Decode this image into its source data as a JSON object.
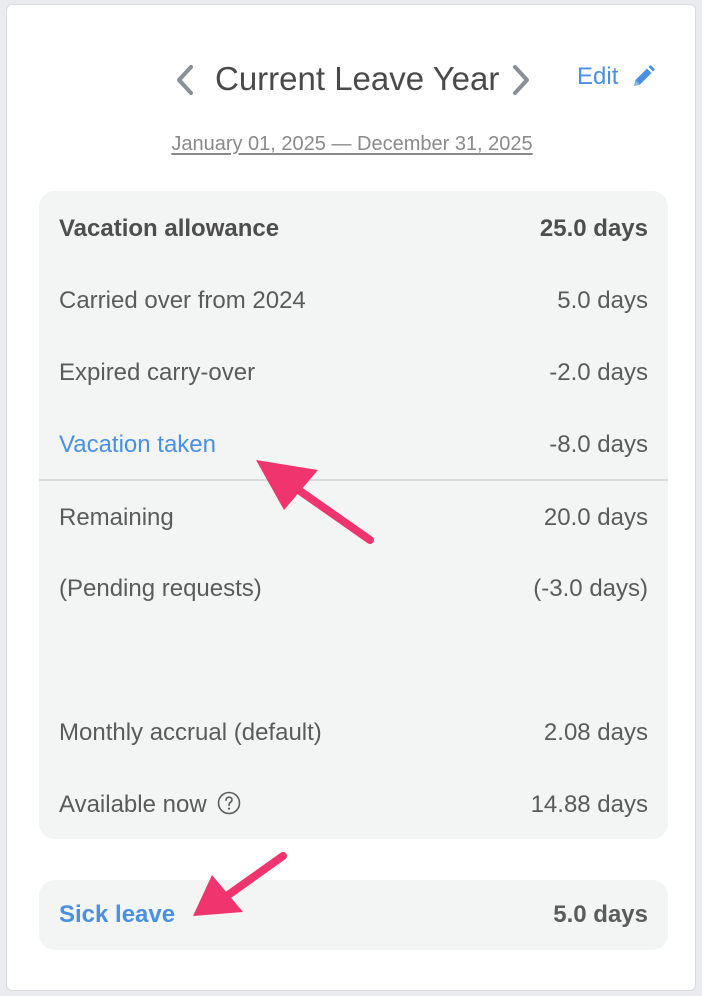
{
  "header": {
    "title": "Current Leave Year",
    "edit_label": "Edit",
    "date_range": "January 01, 2025 — December 31, 2025"
  },
  "vacation": {
    "rows": [
      {
        "label": "Vacation allowance",
        "value": "25.0 days"
      },
      {
        "label": "Carried over from 2024",
        "value": "5.0 days"
      },
      {
        "label": "Expired carry-over",
        "value": "-2.0 days"
      },
      {
        "label": "Vacation taken",
        "value": "-8.0 days"
      },
      {
        "label": "Remaining",
        "value": "20.0 days"
      },
      {
        "label": "(Pending requests)",
        "value": "(-3.0 days)"
      },
      {
        "label": "Monthly accrual (default)",
        "value": "2.08 days"
      },
      {
        "label": "Available now",
        "value": "14.88 days"
      }
    ]
  },
  "sick": {
    "label": "Sick leave",
    "value": "5.0 days"
  },
  "colors": {
    "link": "#4a90e2",
    "annotation_arrow": "#f0346e",
    "panel_bg": "#f3f4f4"
  },
  "icons": {
    "prev": "chevron-left-icon",
    "next": "chevron-right-icon",
    "edit": "pencil-icon",
    "help": "question-circle-icon"
  }
}
